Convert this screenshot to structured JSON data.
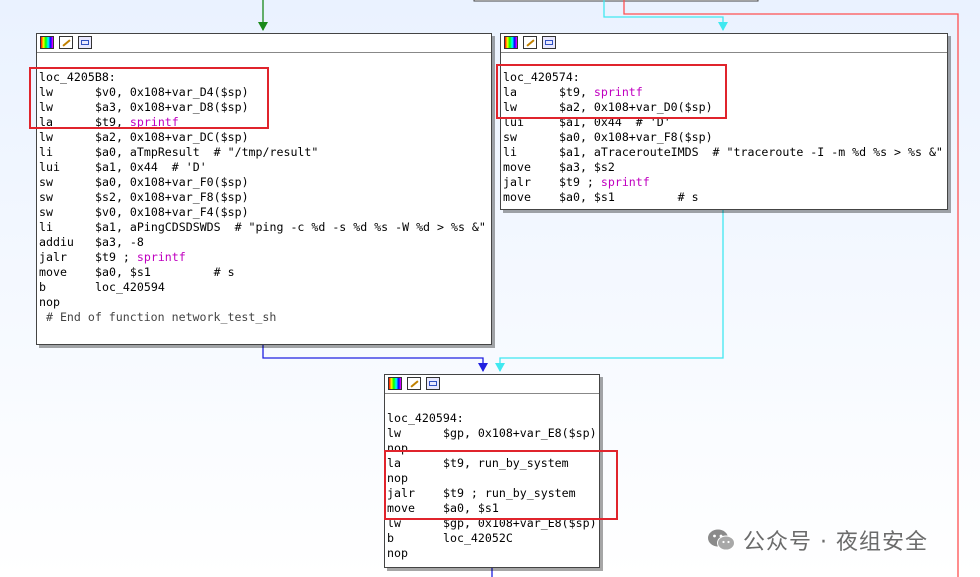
{
  "colors": {
    "edge_green": "#1a8a1a",
    "edge_blue": "#2020e0",
    "edge_cyan": "#40e8f0",
    "edge_red": "#ff5050",
    "highlight": "#e0242c",
    "function_name": "#c000c0"
  },
  "icons": [
    "color-palette-icon",
    "rename-icon",
    "graph-view-icon"
  ],
  "node_left": {
    "lines": [
      {
        "text": "loc_4205B8:"
      },
      {
        "mn": "lw",
        "ops": "$v0, 0x108+var_D4($sp)"
      },
      {
        "mn": "lw",
        "ops": "$a3, 0x108+var_D8($sp)"
      },
      {
        "mn": "la",
        "ops": "$t9, ",
        "fn": "sprintf"
      },
      {
        "mn": "lw",
        "ops": "$a2, 0x108+var_DC($sp)"
      },
      {
        "mn": "li",
        "ops": "$a0, aTmpResult  # \"/tmp/result\""
      },
      {
        "mn": "lui",
        "ops": "$a1, 0x44  # 'D'"
      },
      {
        "mn": "sw",
        "ops": "$a0, 0x108+var_F0($sp)"
      },
      {
        "mn": "sw",
        "ops": "$s2, 0x108+var_F8($sp)"
      },
      {
        "mn": "sw",
        "ops": "$v0, 0x108+var_F4($sp)"
      },
      {
        "mn": "li",
        "ops": "$a1, aPingCDSDSWDS  # \"ping -c %d -s %d %s -W %d > %s &\""
      },
      {
        "mn": "addiu",
        "ops": "$a3, -8"
      },
      {
        "mn": "jalr",
        "ops": "$t9 ; ",
        "fn": "sprintf"
      },
      {
        "mn": "move",
        "ops": "$a0, $s1         # s"
      },
      {
        "mn": "b",
        "ops": "loc_420594"
      },
      {
        "mn": "nop",
        "ops": ""
      },
      {
        "text": " # End of function network_test_sh"
      }
    ]
  },
  "node_right": {
    "lines": [
      {
        "text": "loc_420574:"
      },
      {
        "mn": "la",
        "ops": "$t9, ",
        "fn": "sprintf"
      },
      {
        "mn": "lw",
        "ops": "$a2, 0x108+var_D0($sp)"
      },
      {
        "mn": "lui",
        "ops": "$a1, 0x44  # 'D'"
      },
      {
        "mn": "sw",
        "ops": "$a0, 0x108+var_F8($sp)"
      },
      {
        "mn": "li",
        "ops": "$a1, aTracerouteIMDS  # \"traceroute -I -m %d %s > %s &\""
      },
      {
        "mn": "move",
        "ops": "$a3, $s2"
      },
      {
        "mn": "jalr",
        "ops": "$t9 ; ",
        "fn": "sprintf"
      },
      {
        "mn": "move",
        "ops": "$a0, $s1         # s"
      }
    ]
  },
  "node_bottom": {
    "lines": [
      {
        "text": "loc_420594:"
      },
      {
        "mn": "lw",
        "ops": "$gp, 0x108+var_E8($sp)"
      },
      {
        "mn": "nop",
        "ops": ""
      },
      {
        "mn": "la",
        "ops": "$t9, run_by_system"
      },
      {
        "mn": "nop",
        "ops": ""
      },
      {
        "mn": "jalr",
        "ops": "$t9 ; run_by_system"
      },
      {
        "mn": "move",
        "ops": "$a0, $s1"
      },
      {
        "mn": "lw",
        "ops": "$gp, 0x108+var_E8($sp)"
      },
      {
        "mn": "b",
        "ops": "loc_42052C"
      },
      {
        "mn": "nop",
        "ops": ""
      }
    ]
  },
  "watermark": {
    "text": "公众号 · 夜组安全"
  }
}
